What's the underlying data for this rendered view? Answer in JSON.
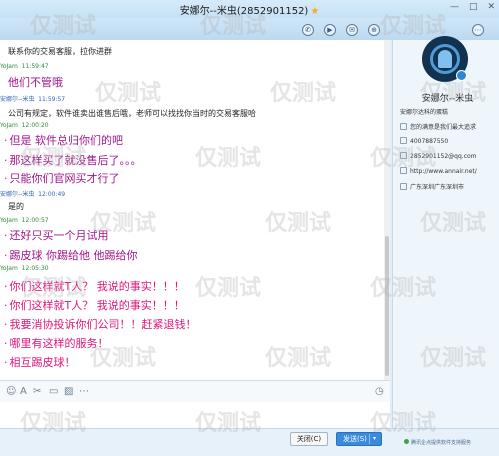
{
  "window": {
    "title": "安娜尔--米虫(2852901152)",
    "star": "★",
    "buttons": [
      "—",
      "□",
      "✕"
    ]
  },
  "toolbar": {
    "icons": [
      "phone-icon",
      "video-icon",
      "share-icon",
      "add-contact-icon",
      "more-icon"
    ],
    "glyphs": [
      "✆",
      "▶",
      "✉",
      "⊕",
      "⋯"
    ]
  },
  "chat": {
    "messages": [
      {
        "kind": "plain",
        "text": "联系你的交易客服，拉你进群"
      },
      {
        "kind": "meta",
        "color": "green",
        "name": "YoJam",
        "time": "11:59:47"
      },
      {
        "kind": "big",
        "color": "purple",
        "bullet": false,
        "text": "他们不管哦"
      },
      {
        "kind": "meta",
        "color": "blue",
        "name": "安娜尔--米虫",
        "time": "11:59:57"
      },
      {
        "kind": "plain",
        "text": "公司有规定，软件谁卖出谁售后哦，老师可以找找你当时的交易客服哈"
      },
      {
        "kind": "meta",
        "color": "green",
        "name": "YoJam",
        "time": "12:00:20"
      },
      {
        "kind": "big",
        "color": "purple",
        "bullet": true,
        "text": "但是 软件总归你们的吧"
      },
      {
        "kind": "big",
        "color": "purple",
        "bullet": true,
        "text": "那这样买了就没售后了。。。"
      },
      {
        "kind": "big",
        "color": "purple",
        "bullet": true,
        "text": "只能你们官网买才行了"
      },
      {
        "kind": "meta",
        "color": "blue",
        "name": "安娜尔--米虫",
        "time": "12:00:49"
      },
      {
        "kind": "plain",
        "text": "是的"
      },
      {
        "kind": "meta",
        "color": "green",
        "name": "YoJam",
        "time": "12:00:57"
      },
      {
        "kind": "big",
        "color": "purple",
        "bullet": true,
        "text": "还好只买一个月试用"
      },
      {
        "kind": "big",
        "color": "purple",
        "bullet": true,
        "text": "踢皮球 你踢给他  他踢给你"
      },
      {
        "kind": "meta",
        "color": "green",
        "name": "YoJam",
        "time": "12:05:30"
      },
      {
        "kind": "big",
        "color": "pink",
        "bullet": true,
        "text": "你们这样就T人？ 我说的事实！！！"
      },
      {
        "kind": "big",
        "color": "pink",
        "bullet": true,
        "text": "你们这样就T人？ 我说的事实！！！"
      },
      {
        "kind": "big",
        "color": "pink",
        "bullet": true,
        "text": "我要消协投诉你们公司！！赶紧退钱！"
      },
      {
        "kind": "big",
        "color": "pink",
        "bullet": true,
        "text": "哪里有这样的服务！"
      },
      {
        "kind": "big",
        "color": "pink",
        "bullet": true,
        "text": "相互踢皮球！"
      }
    ]
  },
  "input_toolbar": {
    "icons": [
      "emoji-icon",
      "font-icon",
      "scissors-icon",
      "file-icon",
      "image-icon",
      "more-icon",
      "history-icon"
    ],
    "glyphs": [
      "☺",
      "A",
      "✂",
      "▭",
      "▨",
      "⋯",
      "◷"
    ]
  },
  "buttons": {
    "close_label": "关闭(C)",
    "send_label": "发送(S)",
    "send_arrow": "▾"
  },
  "profile": {
    "name": "安娜尔--米虫",
    "info": [
      "安娜尔达科的蛋糕",
      "您的满意是我们最大追求",
      "4007887550",
      "2852901152@qq.com",
      "http://www.annair.net/",
      "广东深圳广东深圳市"
    ],
    "notice": "腾讯企点提供软件支持服务"
  },
  "watermark": "仅测试"
}
